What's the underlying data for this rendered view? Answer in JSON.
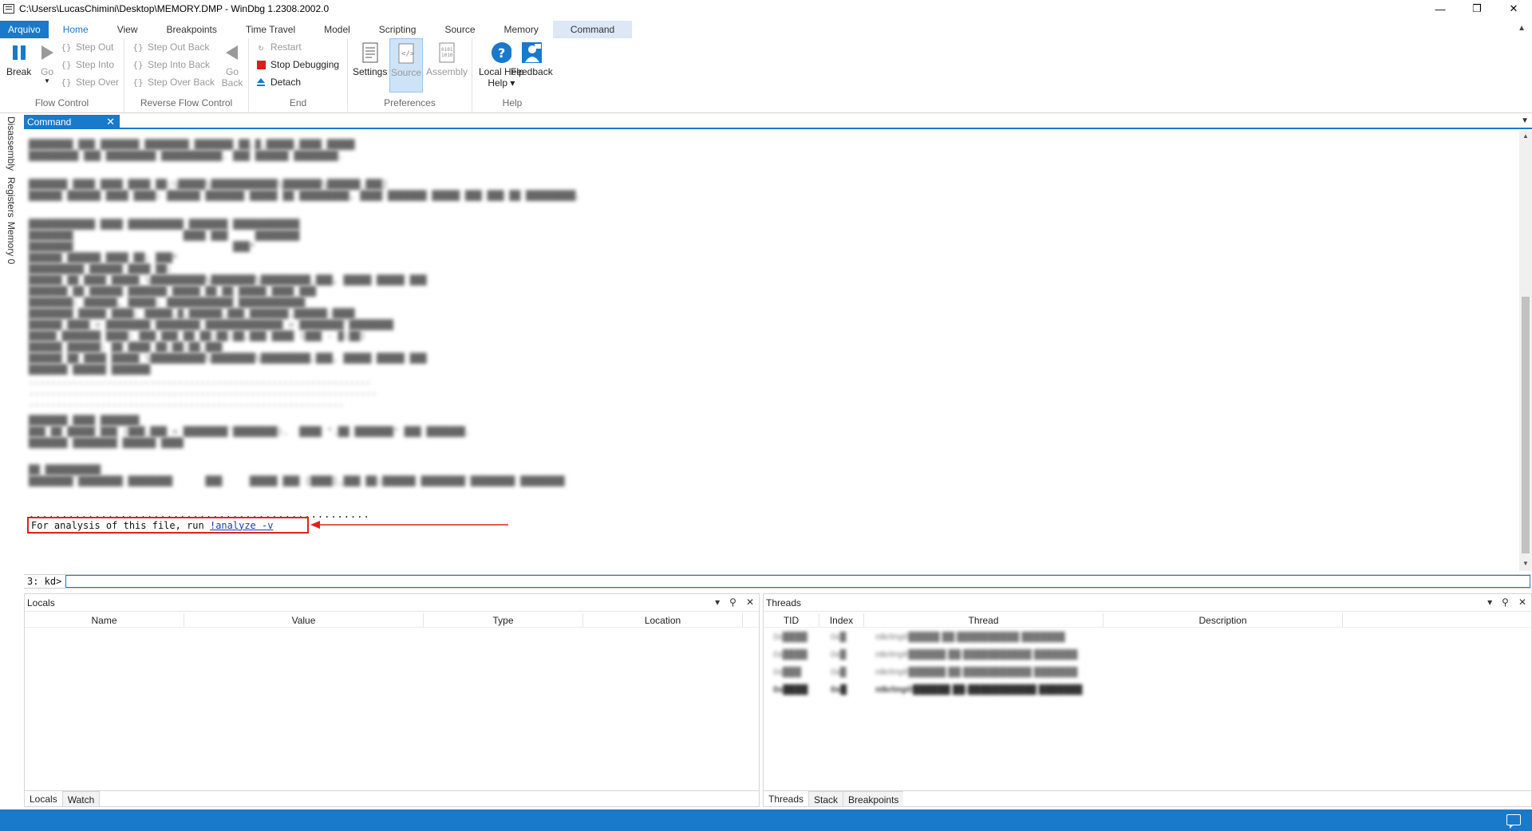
{
  "window": {
    "title": "C:\\Users\\LucasChimini\\Desktop\\MEMORY.DMP - WinDbg 1.2308.2002.0",
    "controls": {
      "minimize": "—",
      "restore": "❐",
      "close": "✕"
    }
  },
  "ribbon": {
    "tabs": [
      "Arquivo",
      "Home",
      "View",
      "Breakpoints",
      "Time Travel",
      "Model",
      "Scripting",
      "Source",
      "Memory",
      "Command"
    ],
    "active_tab": "Home",
    "groups": {
      "flow_control": {
        "label": "Flow Control",
        "break": "Break",
        "go": "Go",
        "step_out": "Step Out",
        "step_into": "Step Into",
        "step_over": "Step Over"
      },
      "reverse_flow": {
        "label": "Reverse Flow Control",
        "step_out_back": "Step Out Back",
        "step_into_back": "Step Into Back",
        "step_over_back": "Step Over Back",
        "go_back": "Go Back"
      },
      "end": {
        "label": "End",
        "restart": "Restart",
        "stop_debugging": "Stop Debugging",
        "detach": "Detach"
      },
      "preferences": {
        "label": "Preferences",
        "settings": "Settings",
        "source": "Source",
        "assembly": "Assembly"
      },
      "help": {
        "label": "Help",
        "local_help": "Local Help",
        "feedback": "Feedback"
      }
    }
  },
  "side_tabs": [
    "Disassembly",
    "Registers",
    "Memory 0"
  ],
  "command_window": {
    "tab_label": "Command",
    "dotted_line": "....................................................",
    "analyze_text": "For analysis of this file, run ",
    "analyze_link": "!analyze -v",
    "prompt": "3: kd>",
    "input_value": ""
  },
  "locals_panel": {
    "title": "Locals",
    "columns": [
      "Name",
      "Value",
      "Type",
      "Location"
    ],
    "tabs": [
      "Locals",
      "Watch"
    ]
  },
  "threads_panel": {
    "title": "Threads",
    "columns": [
      "TID",
      "Index",
      "Thread",
      "Description"
    ],
    "tabs": [
      "Threads",
      "Stack",
      "Breakpoints"
    ]
  },
  "colors": {
    "accent": "#1979ca",
    "highlight_box": "#e0201b",
    "link": "#1a3db5"
  }
}
